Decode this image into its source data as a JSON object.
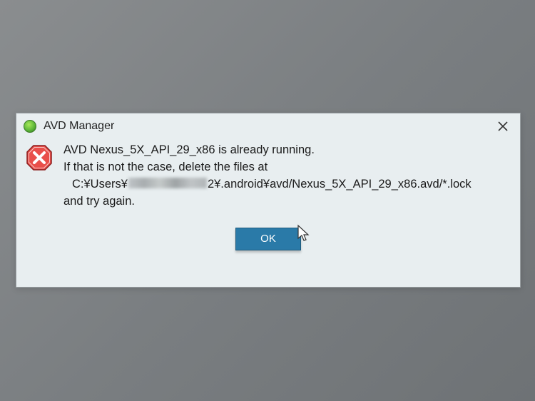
{
  "dialog": {
    "title": "AVD Manager",
    "message": {
      "line1": "AVD Nexus_5X_API_29_x86 is already running.",
      "line2": "If that is not the case, delete the files at",
      "path_prefix": "C:¥Users¥",
      "path_suffix": "2¥.android¥avd/Nexus_5X_API_29_x86.avd/*.lock",
      "line3": "and try again."
    },
    "ok_label": "OK"
  },
  "icons": {
    "error": "error-icon",
    "close": "close-icon",
    "app": "avd-app-icon"
  }
}
